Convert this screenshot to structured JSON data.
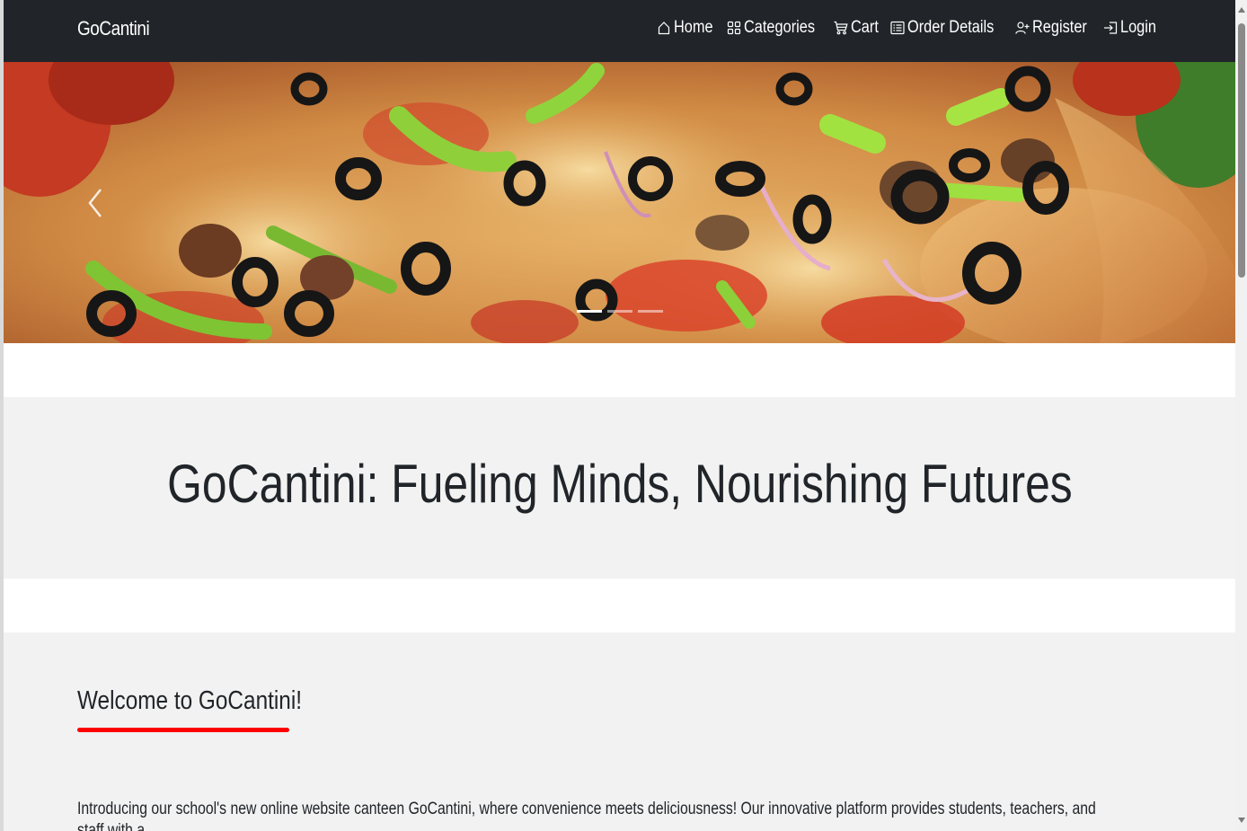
{
  "navbar": {
    "brand": "GoCantini",
    "links": [
      {
        "label": "Home",
        "icon": "house-icon"
      },
      {
        "label": "Categories",
        "icon": "grid-icon"
      },
      {
        "label": "Cart",
        "icon": "cart-icon"
      },
      {
        "label": "Order Details",
        "icon": "list-icon"
      },
      {
        "label": "Register",
        "icon": "person-add-icon"
      },
      {
        "label": "Login",
        "icon": "login-icon"
      }
    ],
    "background": "#212529"
  },
  "carousel": {
    "slide_count": 3,
    "active_slide": 1
  },
  "hero": {
    "title": "GoCantini: Fueling Minds, Nourishing Futures"
  },
  "welcome": {
    "title": "Welcome to GoCantini!",
    "text": "Introducing our school's new online website canteen GoCantini, where convenience meets deliciousness! Our innovative platform provides students, teachers, and staff with a",
    "accent_color": "#ff0000"
  }
}
